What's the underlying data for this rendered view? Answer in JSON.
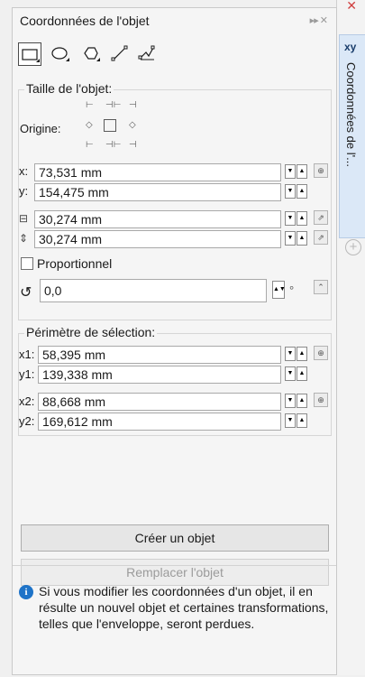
{
  "panel": {
    "title": "Coordonnées de l'objet"
  },
  "docker_tab": {
    "icon_text": "xy",
    "label": "Coordonnées de l'..."
  },
  "toolbar": {
    "tools": [
      "rectangle-tool",
      "ellipse-tool",
      "polygon-tool",
      "line-tool",
      "polyline-tool"
    ],
    "active": "rectangle-tool"
  },
  "size_group": {
    "label": "Taille de l'objet:",
    "origin_label": "Origine:",
    "x_label": "x:",
    "x_value": "73,531 mm",
    "y_label": "y:",
    "y_value": "154,475 mm",
    "width_value": "30,274 mm",
    "height_value": "30,274 mm",
    "proportional_label": "Proportionnel",
    "proportional_checked": false,
    "rotation_value": "0,0",
    "rotation_unit": "°"
  },
  "selection_group": {
    "label": "Périmètre de sélection:",
    "x1_label": "x1:",
    "x1_value": "58,395 mm",
    "y1_label": "y1:",
    "y1_value": "139,338 mm",
    "x2_label": "x2:",
    "x2_value": "88,668 mm",
    "y2_label": "y2:",
    "y2_value": "169,612 mm"
  },
  "buttons": {
    "create_label": "Créer un objet",
    "replace_label": "Remplacer l'objet"
  },
  "info": {
    "text": "Si vous modifier les coordonnées d'un objet, il en résulte un nouvel objet et certaines transformations, telles que l'enveloppe, seront perdues."
  },
  "colors": {
    "accent": "#1e73c8",
    "tab_bg": "#dbe8f7"
  }
}
